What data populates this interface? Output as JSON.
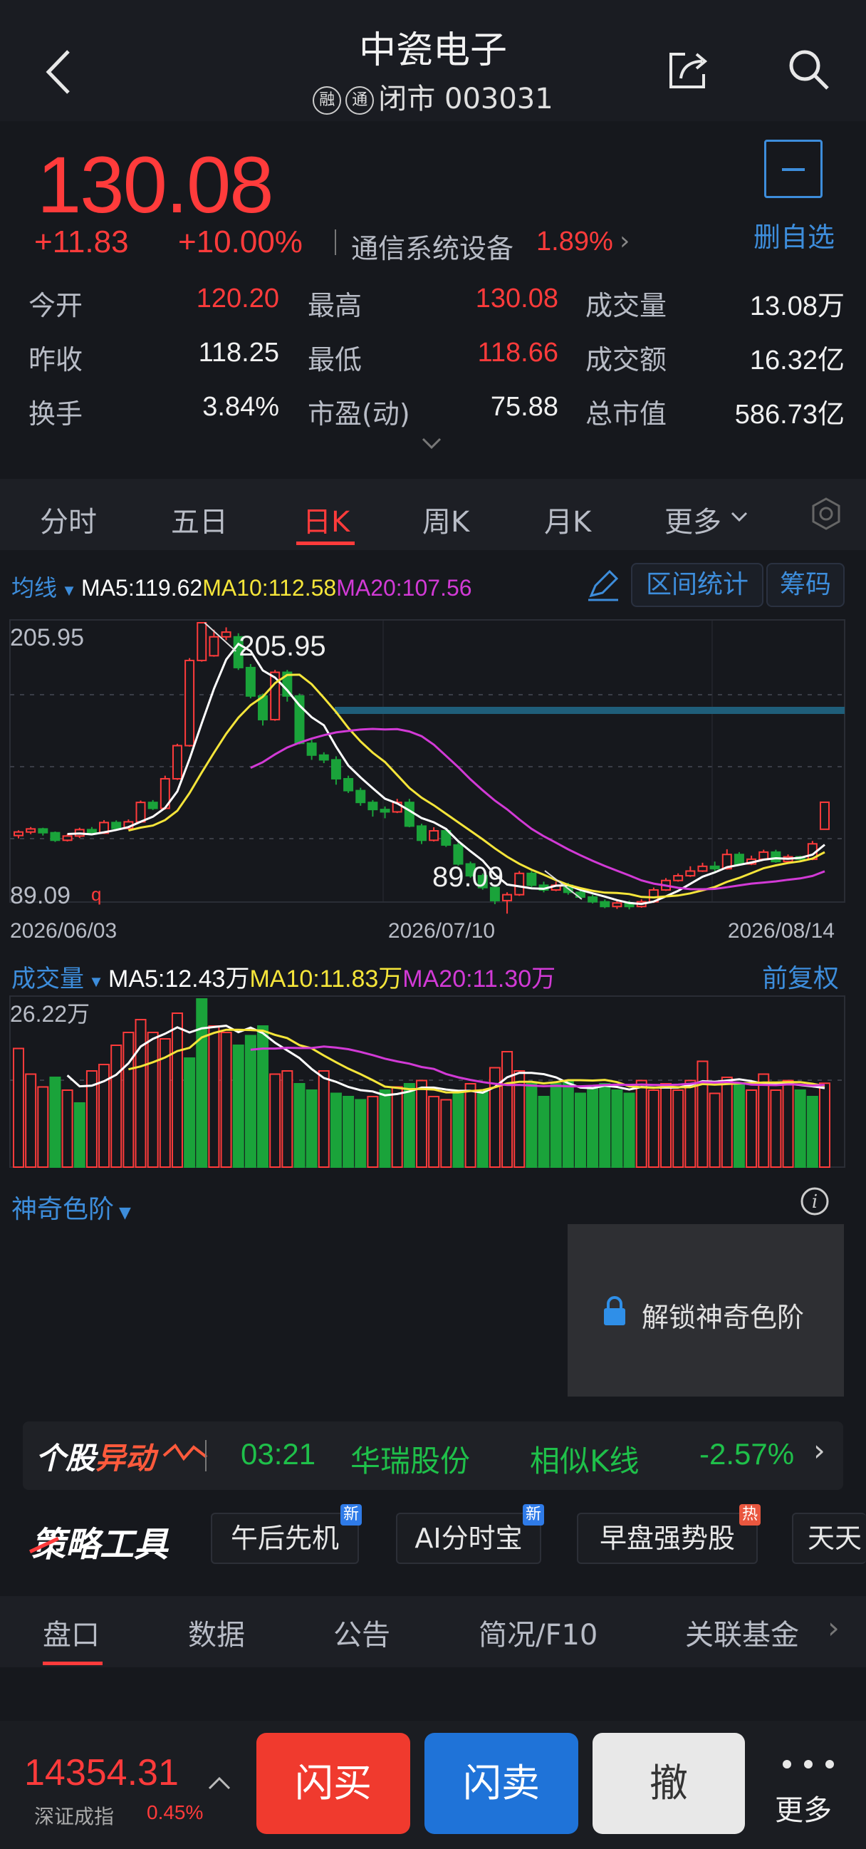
{
  "header": {
    "title": "中瓷电子",
    "badge1": "融",
    "badge2": "通",
    "status": "闭市 003031"
  },
  "quote": {
    "price": "130.08",
    "change": "+11.83",
    "change_pct": "+10.00%",
    "sector": "通信系统设备",
    "sector_pct": "1.89%",
    "watchlist_label": "删自选"
  },
  "stats": [
    {
      "label": "今开",
      "value": "120.20",
      "color": "red"
    },
    {
      "label": "最高",
      "value": "130.08",
      "color": "red"
    },
    {
      "label": "成交量",
      "value": "13.08万",
      "color": "white"
    },
    {
      "label": "昨收",
      "value": "118.25",
      "color": "white"
    },
    {
      "label": "最低",
      "value": "118.66",
      "color": "red"
    },
    {
      "label": "成交额",
      "value": "16.32亿",
      "color": "white"
    },
    {
      "label": "换手",
      "value": "3.84%",
      "color": "white"
    },
    {
      "label": "市盈(动)",
      "value": "75.88",
      "color": "white"
    },
    {
      "label": "总市值",
      "value": "586.73亿",
      "color": "white"
    }
  ],
  "tabs": [
    "分时",
    "五日",
    "日K",
    "周K",
    "月K",
    "更多"
  ],
  "active_tab": "日K",
  "ma_legend": {
    "label": "均线",
    "ma5": "MA5:119.62",
    "ma10": "MA10:112.58",
    "ma20": "MA20:107.56",
    "range_stats": "区间统计",
    "chips": "筹码"
  },
  "price_chart": {
    "y_max_label": "205.95",
    "y_min_label": "89.09",
    "high_marker": "205.95",
    "low_marker": "89.09",
    "q_mark": "q",
    "dates": [
      "2026/06/03",
      "2026/07/10",
      "2026/08/14"
    ]
  },
  "volume_legend": {
    "label": "成交量",
    "ma5": "MA5:12.43万",
    "ma10": "MA10:11.83万",
    "ma20": "MA20:11.30万",
    "adjust": "前复权",
    "y_max_label": "26.22万"
  },
  "magic": {
    "label": "神奇色阶",
    "unlock": "解锁神奇色阶"
  },
  "alert": {
    "logo_a": "个股",
    "logo_b": "异动",
    "time": "03:21",
    "stock": "华瑞股份",
    "type": "相似K线",
    "pct": "-2.57%"
  },
  "tools": {
    "label": "策略工具",
    "items": [
      {
        "name": "午后先机",
        "tag": "新"
      },
      {
        "name": "AI分时宝",
        "tag": "新"
      },
      {
        "name": "早盘强势股",
        "tag": "热"
      },
      {
        "name": "天天",
        "tag": ""
      }
    ]
  },
  "bottom_tabs": [
    "盘口",
    "数据",
    "公告",
    "简况/F10",
    "关联基金"
  ],
  "index": {
    "value": "14354.31",
    "name": "深证成指",
    "pct": "0.45%"
  },
  "actions": {
    "buy": "闪买",
    "sell": "闪卖",
    "cancel": "撤",
    "more": "更多"
  },
  "colors": {
    "up": "#ff3b3b",
    "down": "#1aa33a",
    "accent": "#3d8ddb",
    "ma5": "#ffffff",
    "ma10": "#f5e53a",
    "ma20": "#d23ad6"
  },
  "candles": [
    [
      116.0,
      117.5,
      114.8,
      118.2
    ],
    [
      117.5,
      118.8,
      116.6,
      119.6
    ],
    [
      118.8,
      117.2,
      116.0,
      119.3
    ],
    [
      117.2,
      114.0,
      113.3,
      117.7
    ],
    [
      114.0,
      115.8,
      113.5,
      116.6
    ],
    [
      115.8,
      118.5,
      115.0,
      119.3
    ],
    [
      118.5,
      117.0,
      116.4,
      119.6
    ],
    [
      117.0,
      121.5,
      116.7,
      122.5
    ],
    [
      121.5,
      119.0,
      118.5,
      122.4
    ],
    [
      119.0,
      121.8,
      118.6,
      122.8
    ],
    [
      121.8,
      130.0,
      121.3,
      130.8
    ],
    [
      130.0,
      127.5,
      126.8,
      131.0
    ],
    [
      127.5,
      140.0,
      127.0,
      141.3
    ],
    [
      140.0,
      154.0,
      139.5,
      154.8
    ],
    [
      154.0,
      190.0,
      153.6,
      191.0
    ],
    [
      190.0,
      205.95,
      189.5,
      205.95
    ],
    [
      192.0,
      200.0,
      191.6,
      203.0
    ],
    [
      200.0,
      202.0,
      198.6,
      204.0
    ],
    [
      200.0,
      187.0,
      186.0,
      201.5
    ],
    [
      187.0,
      175.0,
      174.0,
      188.5
    ],
    [
      175.0,
      165.0,
      162.5,
      176.0
    ],
    [
      165.0,
      185.0,
      164.5,
      186.0
    ],
    [
      185.0,
      175.0,
      172.6,
      186.0
    ],
    [
      175.0,
      155.0,
      154.5,
      176.0
    ],
    [
      155.0,
      150.0,
      148.0,
      156.5
    ],
    [
      150.0,
      148.0,
      146.6,
      151.2
    ],
    [
      148.0,
      140.0,
      137.5,
      149.5
    ],
    [
      140.0,
      135.0,
      134.0,
      141.3
    ],
    [
      135.0,
      130.0,
      128.6,
      136.2
    ],
    [
      130.0,
      127.0,
      124.0,
      131.0
    ],
    [
      127.0,
      126.0,
      123.3,
      128.3
    ],
    [
      126.0,
      130.0,
      125.5,
      131.5
    ],
    [
      130.0,
      120.0,
      119.5,
      131.5
    ],
    [
      120.0,
      114.0,
      112.4,
      121.0
    ],
    [
      114.0,
      118.0,
      113.5,
      119.5
    ],
    [
      118.0,
      112.0,
      111.2,
      119.0
    ],
    [
      112.0,
      104.0,
      103.3,
      113.0
    ],
    [
      104.0,
      99.0,
      98.2,
      105.0
    ],
    [
      99.0,
      94.0,
      93.1,
      99.9
    ],
    [
      94.0,
      88.5,
      87.0,
      95.0
    ],
    [
      88.5,
      91.0,
      83.0,
      92.0
    ],
    [
      91.0,
      100.0,
      90.5,
      101.0
    ],
    [
      100.0,
      95.0,
      94.2,
      101.0
    ],
    [
      95.0,
      93.0,
      92.0,
      96.5
    ],
    [
      93.0,
      95.0,
      92.5,
      96.5
    ],
    [
      95.0,
      92.0,
      91.0,
      96.0
    ],
    [
      92.0,
      90.0,
      89.09,
      93.5
    ],
    [
      90.0,
      88.0,
      87.3,
      91.0
    ],
    [
      88.0,
      86.0,
      85.3,
      89.0
    ],
    [
      86.0,
      87.5,
      85.0,
      88.5
    ],
    [
      87.5,
      86.0,
      84.8,
      88.5
    ],
    [
      86.0,
      88.0,
      85.5,
      89.0
    ],
    [
      88.0,
      93.0,
      87.5,
      94.0
    ],
    [
      93.0,
      97.0,
      92.6,
      98.0
    ],
    [
      97.0,
      99.0,
      96.5,
      100.0
    ],
    [
      99.0,
      101.0,
      98.5,
      103.0
    ],
    [
      101.0,
      103.0,
      100.6,
      104.5
    ],
    [
      103.0,
      102.0,
      101.0,
      105.0
    ],
    [
      102.0,
      108.0,
      101.6,
      110.2
    ],
    [
      108.0,
      104.0,
      103.5,
      109.0
    ],
    [
      104.0,
      106.0,
      103.5,
      107.5
    ],
    [
      106.0,
      109.0,
      105.5,
      110.0
    ],
    [
      109.0,
      105.0,
      104.5,
      110.0
    ],
    [
      105.0,
      107.0,
      104.5,
      108.0
    ],
    [
      107.0,
      106.0,
      105.5,
      107.5
    ],
    [
      106.0,
      112.5,
      105.6,
      113.7
    ],
    [
      118.66,
      130.08,
      118.66,
      130.08
    ]
  ],
  "volumes": [
    [
      18.5,
      1
    ],
    [
      14.5,
      1
    ],
    [
      12.5,
      1
    ],
    [
      14,
      0
    ],
    [
      12,
      1
    ],
    [
      10,
      0
    ],
    [
      15,
      1
    ],
    [
      16,
      1
    ],
    [
      19,
      1
    ],
    [
      21,
      1
    ],
    [
      23,
      1
    ],
    [
      21,
      1
    ],
    [
      20,
      1
    ],
    [
      24,
      1
    ],
    [
      17,
      0
    ],
    [
      26.22,
      0
    ],
    [
      22,
      1
    ],
    [
      21,
      1
    ],
    [
      19,
      0
    ],
    [
      20.5,
      0
    ],
    [
      22,
      0
    ],
    [
      14.5,
      1
    ],
    [
      15,
      1
    ],
    [
      13,
      0
    ],
    [
      12,
      0
    ],
    [
      15,
      1
    ],
    [
      11.5,
      0
    ],
    [
      11,
      0
    ],
    [
      10.5,
      0
    ],
    [
      11,
      1
    ],
    [
      12,
      0
    ],
    [
      12.5,
      1
    ],
    [
      13,
      0
    ],
    [
      13.5,
      1
    ],
    [
      11,
      1
    ],
    [
      10.5,
      1
    ],
    [
      11.5,
      0
    ],
    [
      13,
      1
    ],
    [
      12,
      0
    ],
    [
      15.5,
      1
    ],
    [
      18,
      1
    ],
    [
      15,
      1
    ],
    [
      13,
      0
    ],
    [
      11,
      0
    ],
    [
      13,
      0
    ],
    [
      13.5,
      0
    ],
    [
      11.5,
      0
    ],
    [
      12.5,
      0
    ],
    [
      13,
      0
    ],
    [
      12,
      0
    ],
    [
      11.5,
      0
    ],
    [
      13.5,
      1
    ],
    [
      12,
      1
    ],
    [
      13,
      1
    ],
    [
      12,
      1
    ],
    [
      13.5,
      1
    ],
    [
      16.5,
      1
    ],
    [
      11.5,
      1
    ],
    [
      14,
      1
    ],
    [
      13,
      0
    ],
    [
      12,
      1
    ],
    [
      14.5,
      1
    ],
    [
      12,
      1
    ],
    [
      13.5,
      1
    ],
    [
      12,
      0
    ],
    [
      11,
      0
    ],
    [
      13.08,
      1
    ]
  ]
}
